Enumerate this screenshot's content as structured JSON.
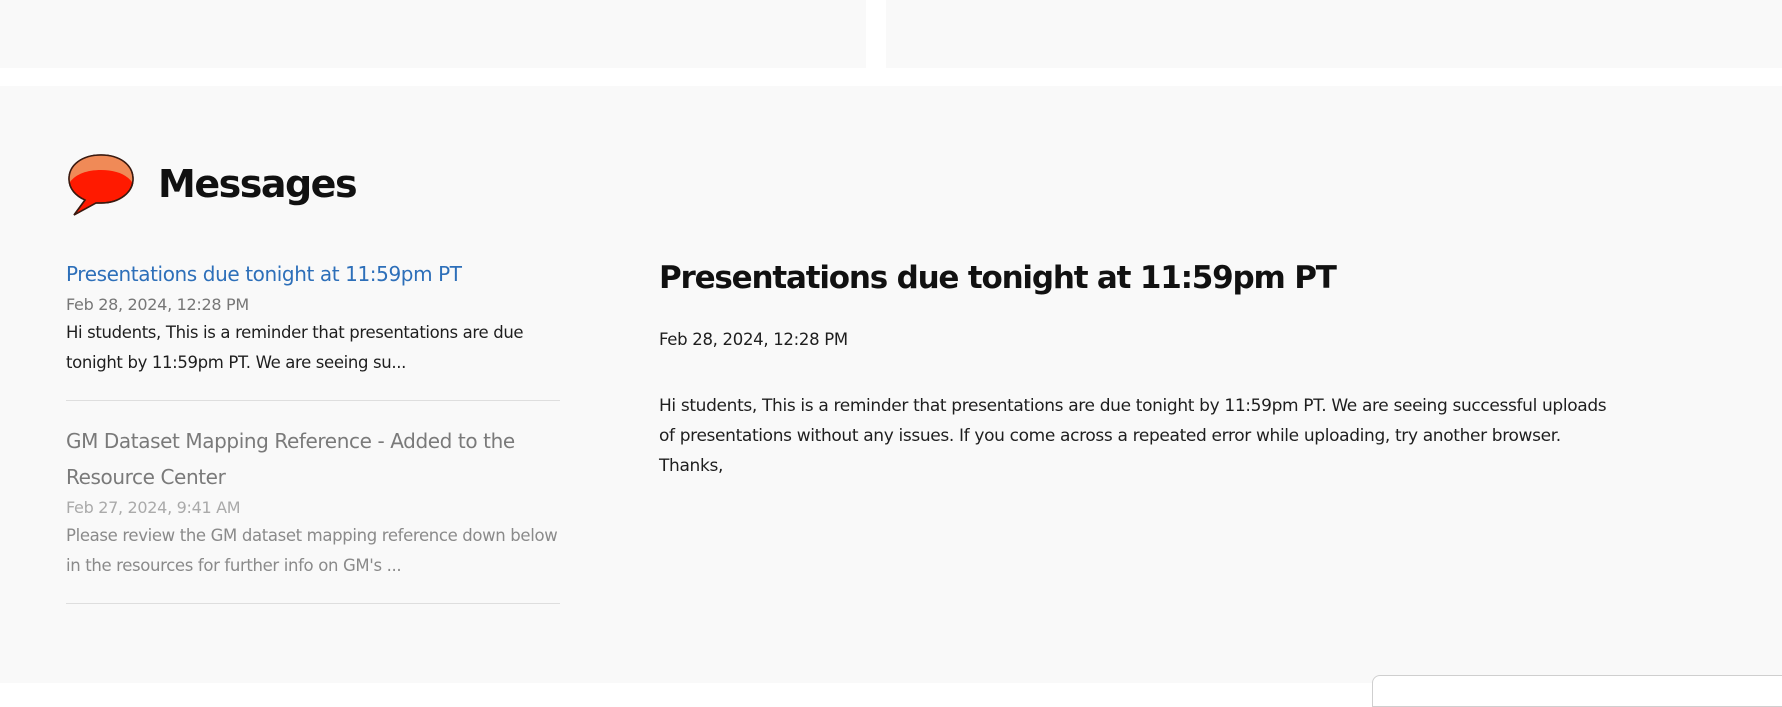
{
  "messages": {
    "title": "Messages",
    "icon": "speech-bubble-icon",
    "items": [
      {
        "title": "Presentations due tonight at 11:59pm PT",
        "date": "Feb 28, 2024, 12:28 PM",
        "excerpt": "Hi students, This is a reminder that presentations are due tonight by 11:59pm PT. We are seeing su...",
        "selected": true
      },
      {
        "title": "GM Dataset Mapping Reference - Added to the Resource Center",
        "date": "Feb 27, 2024, 9:41 AM",
        "excerpt": "Please review the GM dataset mapping reference down below in the resources for further info on GM's ...",
        "selected": false
      }
    ]
  },
  "detail": {
    "title": "Presentations due tonight at 11:59pm PT",
    "date": "Feb 28, 2024, 12:28 PM",
    "body": "Hi students, This is a reminder that presentations are due tonight by 11:59pm PT. We are seeing successful uploads of presentations without any issues. If you come across a repeated error while uploading, try another browser. Thanks,"
  },
  "colors": {
    "link_active": "#2d6fb9",
    "bubble_top": "#f08a57",
    "bubble_body": "#ff1a00"
  }
}
